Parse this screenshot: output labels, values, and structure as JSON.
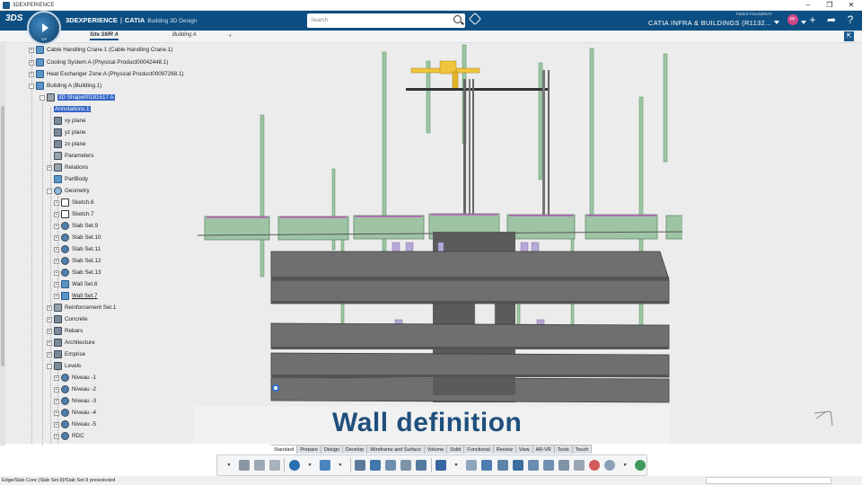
{
  "window": {
    "title": "3DEXPERIENCE"
  },
  "header": {
    "brand_bold": "3DEXPERIENCE",
    "brand_sep": "|",
    "brand_app": "CATIA",
    "brand_sub": "Building 3D Design",
    "compass_label": "V,R",
    "search_placeholder": "Search",
    "user_name": "Patrick FOUGERAY",
    "role": "CATIA INFRA & BUILDINGS (R1132...",
    "avatar_initials": "PF",
    "colors": {
      "bar": "#0d4f82",
      "accent": "#d1478a"
    }
  },
  "tabs": [
    {
      "label": "Site SMR A",
      "active": true
    },
    {
      "label": "Building A",
      "active": false
    }
  ],
  "tree": {
    "items": [
      {
        "label": "Cable Handling Crane.1 (Cable Handling Crane.1)",
        "icon": "product-icon"
      },
      {
        "label": "Cooling System A (Physical Product00042448.1)",
        "icon": "product-icon"
      },
      {
        "label": "Heat Exchanger Zone A (Physical Product00097268.1)",
        "icon": "product-icon"
      },
      {
        "label": "Building A (Building.1)",
        "icon": "building-icon"
      },
      {
        "label": "3D Shape00181517 A",
        "icon": "shape-icon"
      },
      {
        "label": "Annotations.1",
        "icon": "annotation-icon"
      },
      {
        "label": "xy plane",
        "icon": "plane-icon"
      },
      {
        "label": "yz plane",
        "icon": "plane-icon"
      },
      {
        "label": "zx plane",
        "icon": "plane-icon"
      },
      {
        "label": "Parameters",
        "icon": "parameters-icon"
      },
      {
        "label": "Relations",
        "icon": "relations-icon"
      },
      {
        "label": "PartBody",
        "icon": "partbody-icon"
      },
      {
        "label": "Geometry",
        "icon": "geometry-icon"
      },
      {
        "label": "Sketch.6",
        "icon": "sketch-icon"
      },
      {
        "label": "Sketch.7",
        "icon": "sketch-icon"
      },
      {
        "label": "Slab Set.9",
        "icon": "slab-icon"
      },
      {
        "label": "Slab Set.10",
        "icon": "slab-icon"
      },
      {
        "label": "Slab Set.11",
        "icon": "slab-icon"
      },
      {
        "label": "Slab Set.12",
        "icon": "slab-icon"
      },
      {
        "label": "Slab Set.13",
        "icon": "slab-icon"
      },
      {
        "label": "Wall Set.6",
        "icon": "wall-icon"
      },
      {
        "label": "Wall Set.7",
        "icon": "wall-icon"
      },
      {
        "label": "Reinforcement Set.1",
        "icon": "reinforcement-icon"
      },
      {
        "label": "Concrete",
        "icon": "concrete-icon"
      },
      {
        "label": "Rebars",
        "icon": "rebars-icon"
      },
      {
        "label": "Architecture",
        "icon": "architecture-icon"
      },
      {
        "label": "Emprise",
        "icon": "emprise-icon"
      },
      {
        "label": "Levels",
        "icon": "levels-icon"
      },
      {
        "label": "Niveau -1",
        "icon": "level-icon"
      },
      {
        "label": "Niveau -2",
        "icon": "level-icon"
      },
      {
        "label": "Niveau -3",
        "icon": "level-icon"
      },
      {
        "label": "Niveau -4",
        "icon": "level-icon"
      },
      {
        "label": "Niveau -5",
        "icon": "level-icon"
      },
      {
        "label": "RDC",
        "icon": "level-icon"
      }
    ]
  },
  "overlay": {
    "caption": "Wall definition"
  },
  "ribbon": {
    "tabs": [
      "Standard",
      "Prepare",
      "Design",
      "Develop",
      "Wireframe and Surface",
      "Volume",
      "Solid",
      "Functional",
      "Review",
      "View",
      "AR-VR",
      "Tools",
      "Touch"
    ],
    "active": "Standard"
  },
  "status": {
    "text": "Edge/Slab Core (Slab Set.9)/Slab Set.9 preselected"
  }
}
